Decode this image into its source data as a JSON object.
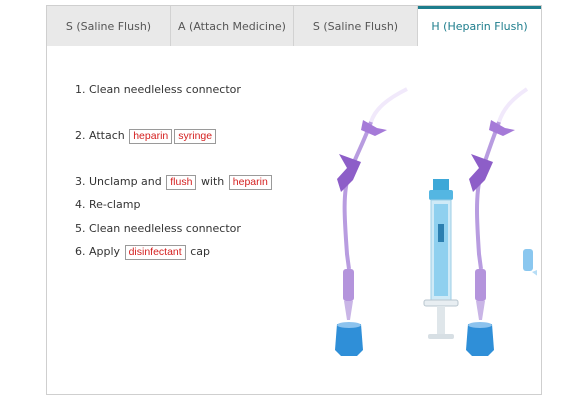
{
  "tabs": [
    {
      "label": "S (Saline Flush)",
      "active": false
    },
    {
      "label": "A (Attach Medicine)",
      "active": false
    },
    {
      "label": "S (Saline Flush)",
      "active": false
    },
    {
      "label": "H (Heparin Flush)",
      "active": true
    }
  ],
  "steps": {
    "s1": {
      "text": "1. Clean needleless connector"
    },
    "s2": {
      "prefix": "2. Attach",
      "chip1": "heparin",
      "chip2": "syringe"
    },
    "s3": {
      "prefix": "3. Unclamp and",
      "chip1": "flush",
      "mid": "with",
      "chip2": "heparin"
    },
    "s4": {
      "text": "4. Re-clamp"
    },
    "s5": {
      "text": "5. Clean needleless connector"
    },
    "s6": {
      "prefix": "6. Apply",
      "chip1": "disinfectant",
      "suffix": "cap"
    }
  },
  "colors": {
    "accent": "#1d7d8c",
    "chip_text": "#d42020",
    "tubing": "#a586d6",
    "cap": "#2f8fd8"
  },
  "icons": [
    "iv-line-illustration",
    "syringe-illustration",
    "iv-line-with-cap-illustration",
    "disinfectant-cap-icon"
  ]
}
